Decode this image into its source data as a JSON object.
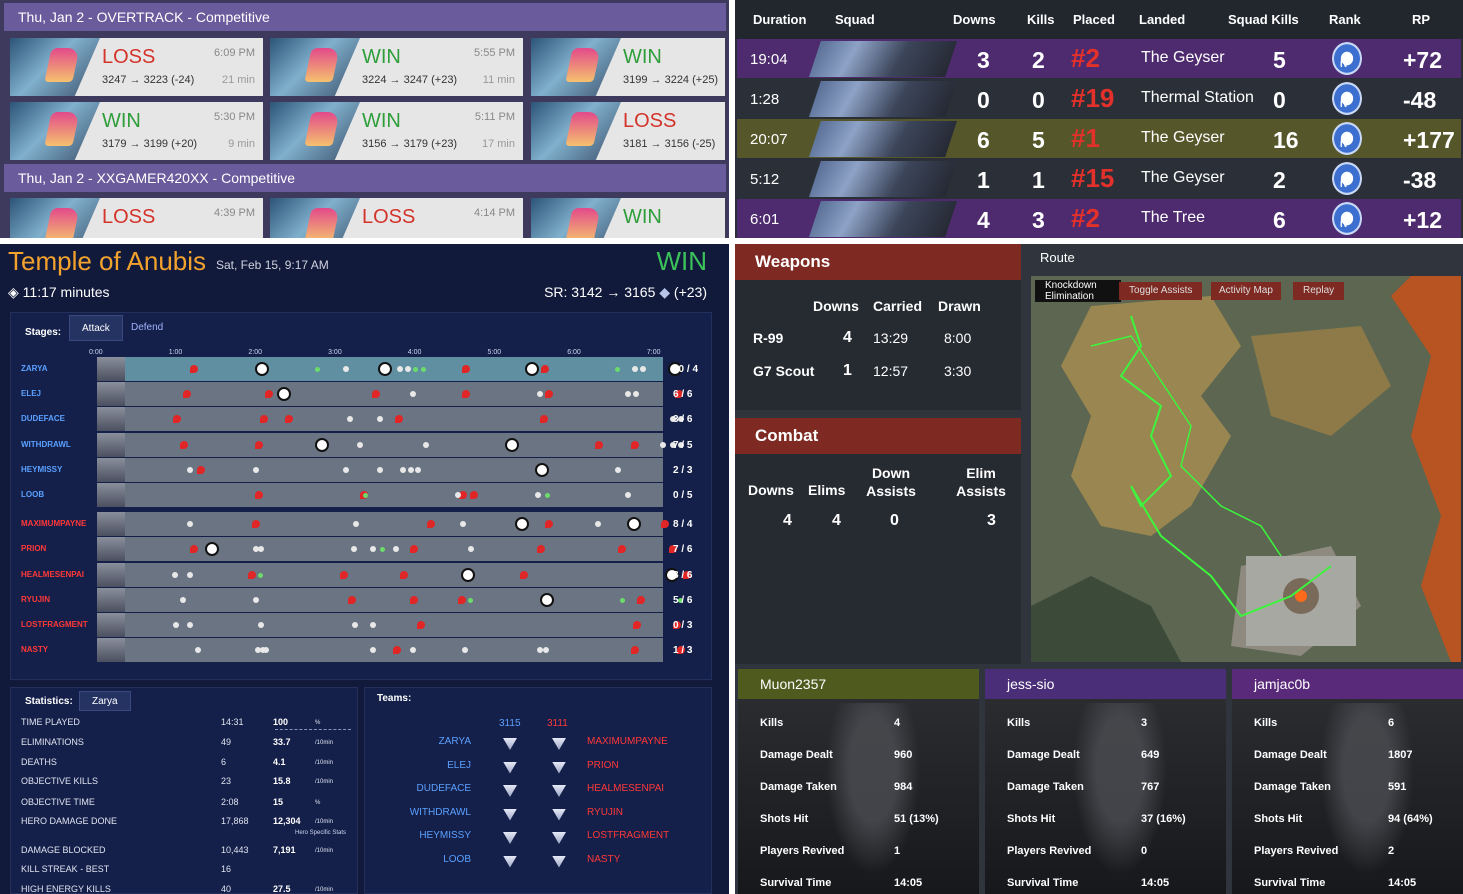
{
  "overtrack": {
    "days": [
      {
        "header": "Thu, Jan 2 - OVERTRACK - Competitive",
        "games": [
          {
            "result": "LOSS",
            "time": "6:09 PM",
            "sr": "3247 → 3223 (-24)",
            "duration": "21 min"
          },
          {
            "result": "WIN",
            "time": "5:55 PM",
            "sr": "3224 → 3247 (+23)",
            "duration": "11 min"
          },
          {
            "result": "WIN",
            "time": "",
            "sr": "3199 → 3224 (+25)",
            "duration": ""
          },
          {
            "result": "WIN",
            "time": "5:30 PM",
            "sr": "3179 → 3199 (+20)",
            "duration": "9 min"
          },
          {
            "result": "WIN",
            "time": "5:11 PM",
            "sr": "3156 → 3179 (+23)",
            "duration": "17 min"
          },
          {
            "result": "LOSS",
            "time": "",
            "sr": "3181 → 3156 (-25)",
            "duration": ""
          }
        ]
      },
      {
        "header": "Thu, Jan 2 - XXGAMER420XX - Competitive",
        "games": [
          {
            "result": "LOSS",
            "time": "4:39 PM",
            "sr": "",
            "duration": ""
          },
          {
            "result": "LOSS",
            "time": "4:14 PM",
            "sr": "",
            "duration": ""
          },
          {
            "result": "WIN",
            "time": "",
            "sr": "",
            "duration": ""
          }
        ]
      }
    ]
  },
  "apex_matches": {
    "headers": [
      "Duration",
      "Squad",
      "Downs",
      "Kills",
      "Placed",
      "Landed",
      "Squad Kills",
      "Rank",
      "RP"
    ],
    "rows": [
      {
        "duration": "19:04",
        "downs": "3",
        "kills": "2",
        "placed": "#2",
        "landed": "The Geyser",
        "squad_kills": "5",
        "rank": "IV",
        "rp": "+72",
        "color": "#4e2a6e"
      },
      {
        "duration": "1:28",
        "downs": "0",
        "kills": "0",
        "placed": "#19",
        "landed": "Thermal Station",
        "squad_kills": "0",
        "rank": "IV",
        "rp": "-48",
        "color": "#2b2f38"
      },
      {
        "duration": "20:07",
        "downs": "6",
        "kills": "5",
        "placed": "#1",
        "landed": "The Geyser",
        "squad_kills": "16",
        "rank": "IV",
        "rp": "+177",
        "color": "#55562a"
      },
      {
        "duration": "5:12",
        "downs": "1",
        "kills": "1",
        "placed": "#15",
        "landed": "The Geyser",
        "squad_kills": "2",
        "rank": "IV",
        "rp": "-38",
        "color": "#2b2f38"
      },
      {
        "duration": "6:01",
        "downs": "4",
        "kills": "3",
        "placed": "#2",
        "landed": "The Tree",
        "squad_kills": "6",
        "rank": "IV",
        "rp": "+12",
        "color": "#4e2a6e"
      }
    ]
  },
  "ow_game": {
    "map": "Temple of Anubis",
    "date": "Sat, Feb 15, 9:17 AM",
    "result": "WIN",
    "duration": "11:17 minutes",
    "sr": "SR: 3142 → 3165",
    "sr_delta": "(+23)",
    "stages_label": "Stages:",
    "tabs": [
      "Attack",
      "Defend"
    ],
    "ticks": [
      "0:00",
      "1:00",
      "2:00",
      "3:00",
      "4:00",
      "5:00",
      "6:00",
      "7:00"
    ],
    "players": [
      {
        "name": "ZARYA",
        "kd": "10 / 4",
        "team": "blue"
      },
      {
        "name": "ELEJ",
        "kd": "6 / 6",
        "team": "blue"
      },
      {
        "name": "DUDEFACE",
        "kd": "3 / 6",
        "team": "blue"
      },
      {
        "name": "WITHDRAWL",
        "kd": "7 / 5",
        "team": "blue"
      },
      {
        "name": "HEYMISSY",
        "kd": "2 / 3",
        "team": "blue"
      },
      {
        "name": "LOOB",
        "kd": "0 / 5",
        "team": "blue"
      },
      {
        "name": "MAXIMUMPAYNE",
        "kd": "8 / 4",
        "team": "red"
      },
      {
        "name": "PRION",
        "kd": "7 / 6",
        "team": "red"
      },
      {
        "name": "HEALMESENPAI",
        "kd": "8 / 6",
        "team": "red"
      },
      {
        "name": "RYUJIN",
        "kd": "5 / 6",
        "team": "red"
      },
      {
        "name": "LOSTFRAGMENT",
        "kd": "0 / 3",
        "team": "red"
      },
      {
        "name": "NASTY",
        "kd": "1 / 3",
        "team": "red"
      }
    ],
    "stats_label": "Statistics:",
    "stats_hero": "Zarya",
    "stats": [
      {
        "label": "TIME PLAYED",
        "value": "14:31",
        "rate": "100",
        "unit": "%"
      },
      {
        "label": "ELIMINATIONS",
        "value": "49",
        "rate": "33.7",
        "unit": "/10min"
      },
      {
        "label": "DEATHS",
        "value": "6",
        "rate": "4.1",
        "unit": "/10min"
      },
      {
        "label": "OBJECTIVE KILLS",
        "value": "23",
        "rate": "15.8",
        "unit": "/10min"
      },
      {
        "label": "OBJECTIVE TIME",
        "value": "2:08",
        "rate": "15",
        "unit": "%"
      },
      {
        "label": "HERO DAMAGE DONE",
        "value": "17,868",
        "rate": "12,304",
        "unit": "/10min"
      },
      {
        "label": "DAMAGE BLOCKED",
        "value": "10,443",
        "rate": "7,191",
        "unit": "/10min"
      },
      {
        "label": "KILL STREAK - BEST",
        "value": "16",
        "rate": "",
        "unit": ""
      },
      {
        "label": "HIGH ENERGY KILLS",
        "value": "40",
        "rate": "27.5",
        "unit": "/10min"
      }
    ],
    "hero_specific": "Hero Specific Stats",
    "teams_label": "Teams:",
    "team_blue_sr": "3115",
    "team_red_sr": "3111",
    "team_blue": [
      "ZARYA",
      "ELEJ",
      "DUDEFACE",
      "WITHDRAWL",
      "HEYMISSY",
      "LOOB"
    ],
    "team_red": [
      "MAXIMUMPAYNE",
      "PRION",
      "HEALMESENPAI",
      "RYUJIN",
      "LOSTFRAGMENT",
      "NASTY"
    ]
  },
  "apex_game": {
    "weapons_title": "Weapons",
    "weapon_headers": [
      "Downs",
      "Carried",
      "Drawn"
    ],
    "weapons": [
      {
        "name": "R-99",
        "downs": "4",
        "carried": "13:29",
        "drawn": "8:00"
      },
      {
        "name": "G7 Scout",
        "downs": "1",
        "carried": "12:57",
        "drawn": "3:30"
      }
    ],
    "combat_title": "Combat",
    "combat_headers": [
      "Downs",
      "Elims",
      "Down Assists",
      "Elim Assists"
    ],
    "combat_values": [
      "4",
      "4",
      "0",
      "3"
    ],
    "route_title": "Route",
    "legend": [
      "Knockdown",
      "Elimination"
    ],
    "route_buttons": [
      "Toggle Assists",
      "Activity Map",
      "Replay"
    ],
    "players": [
      {
        "name": "Muon2357",
        "color": "#4f5a1e",
        "kills": "4",
        "damage_dealt": "960",
        "damage_taken": "984",
        "shots_hit": "51 (13%)",
        "revived": "1",
        "survival": "14:05"
      },
      {
        "name": "jess-sio",
        "color": "#4a2e78",
        "kills": "3",
        "damage_dealt": "649",
        "damage_taken": "767",
        "shots_hit": "37 (16%)",
        "revived": "0",
        "survival": "14:05"
      },
      {
        "name": "jamjac0b",
        "color": "#5a2a7a",
        "kills": "6",
        "damage_dealt": "1807",
        "damage_taken": "591",
        "shots_hit": "94 (64%)",
        "revived": "2",
        "survival": "14:05"
      }
    ],
    "stat_labels": [
      "Kills",
      "Damage Dealt",
      "Damage Taken",
      "Shots Hit",
      "Players Revived",
      "Survival Time"
    ]
  }
}
